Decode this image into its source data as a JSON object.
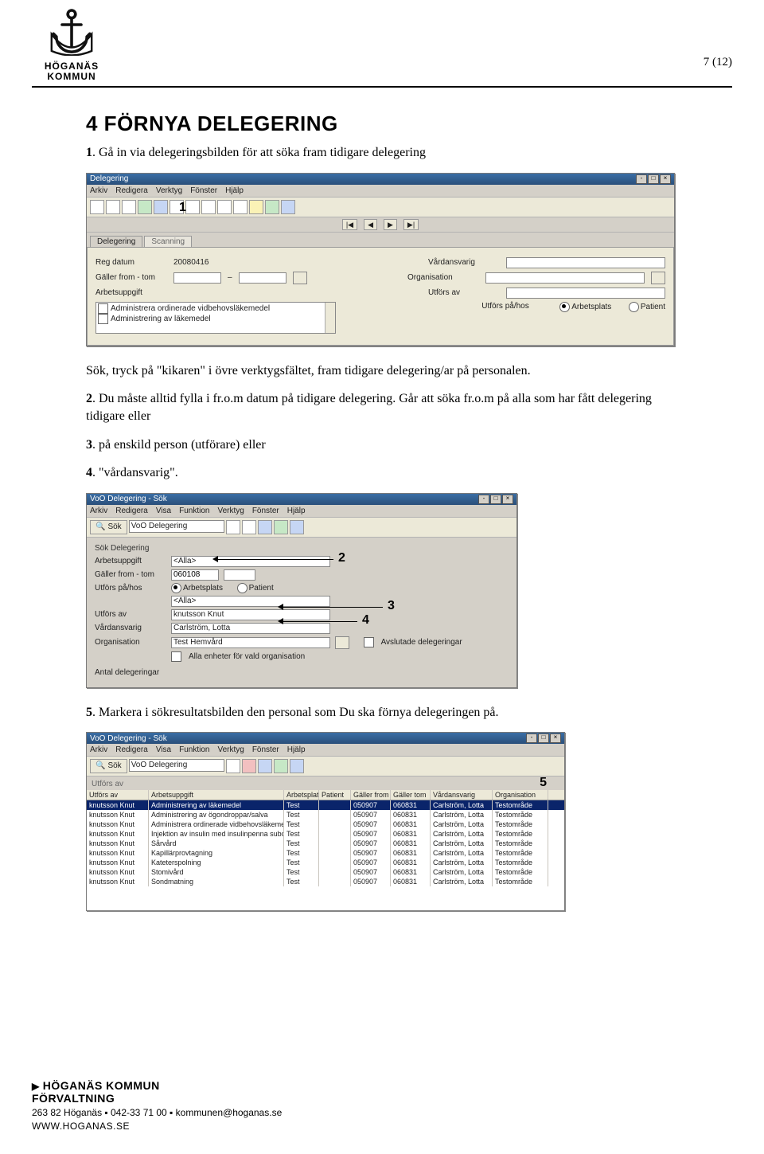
{
  "page": {
    "number_label": "7 (12)"
  },
  "header": {
    "logo_line1": "HÖGANÄS",
    "logo_line2": "KOMMUN"
  },
  "section": {
    "title": "4  FÖRNYA DELEGERING",
    "p1_prefix": "1",
    "p1_text": ". Gå in via delegeringsbilden för att söka fram tidigare delegering",
    "p2": "Sök, tryck på \"kikaren\" i övre verktygsfältet, fram tidigare delegering/ar på personalen.",
    "p3_prefix": "2",
    "p3_text": ". Du måste alltid fylla i fr.o.m datum på tidigare delegering. Går att söka fr.o.m på alla som har fått delegering tidigare eller",
    "p4_prefix": "3",
    "p4_text": ". på enskild person (utförare) eller",
    "p5_prefix": "4",
    "p5_text": ". \"vårdansvarig\".",
    "p6_prefix": "5",
    "p6_text": ". Markera i sökresultatsbilden den personal som Du ska förnya delegeringen på."
  },
  "win1": {
    "title": "Delegering",
    "menu": [
      "Arkiv",
      "Redigera",
      "Verktyg",
      "Fönster",
      "Hjälp"
    ],
    "nav": [
      "|◀",
      "◀",
      "▶",
      "▶|"
    ],
    "tabs": [
      "Delegering",
      "Scanning"
    ],
    "annotation_value": "1",
    "reg_datum_label": "Reg datum",
    "reg_datum_value": "20080416",
    "galler_label": "Gäller from - tom",
    "arbets_label": "Arbetsuppgift",
    "vardansvarig_label": "Vårdansvarig",
    "organisation_label": "Organisation",
    "utfors_av_label": "Utförs av",
    "utfors_pa_label": "Utförs på/hos",
    "radio_arb": "Arbetsplats",
    "radio_pat": "Patient",
    "list_items": [
      "Administrera ordinerade vidbehovsläkemedel",
      "Administrering av läkemedel"
    ]
  },
  "win2": {
    "title": "VoO Delegering - Sök",
    "menu": [
      "Arkiv",
      "Redigera",
      "Visa",
      "Funktion",
      "Verktyg",
      "Fönster",
      "Hjälp"
    ],
    "search_btn": "Sök",
    "search_combo": "VoO Delegering",
    "section": "Sök Delegering",
    "arbets_label": "Arbetsuppgift",
    "arbets_value": "<Alla>",
    "galler_label": "Gäller from - tom",
    "galler_value": "060108",
    "utfors_pa_label": "Utförs på/hos",
    "radio_arb": "Arbetsplats",
    "radio_pat": "Patient",
    "plats_value": "<Alla>",
    "utfors_av_label": "Utförs av",
    "utfors_av_value": "knutsson Knut",
    "vardansvarig_label": "Vårdansvarig",
    "vardansvarig_value": "Carlström, Lotta",
    "organisation_label": "Organisation",
    "organisation_value": "Test Hemvård",
    "chk_avslutade": "Avslutade delegeringar",
    "chk_alla_enh": "Alla enheter för vald organisation",
    "antal_label": "Antal delegeringar",
    "ann2": "2",
    "ann3": "3",
    "ann4": "4"
  },
  "win3": {
    "title": "VoO Delegering - Sök",
    "menu": [
      "Arkiv",
      "Redigera",
      "Visa",
      "Funktion",
      "Verktyg",
      "Fönster",
      "Hjälp"
    ],
    "search_btn": "Sök",
    "search_combo": "VoO Delegering",
    "utfors_av_label": "Utförs av",
    "columns": [
      "Utförs av",
      "Arbetsuppgift",
      "Arbetsplats",
      "Patient",
      "Gäller from",
      "Gäller tom",
      "Vårdansvarig",
      "Organisation"
    ],
    "ann5": "5",
    "rows": [
      {
        "c": [
          "knutsson Knut",
          "Administrering av läkemedel",
          "Test",
          "",
          "050907",
          "060831",
          "Carlström, Lotta",
          "Testområde"
        ],
        "sel": true
      },
      {
        "c": [
          "knutsson Knut",
          "Administrering av ögondroppar/salva",
          "Test",
          "",
          "050907",
          "060831",
          "Carlström, Lotta",
          "Testområde"
        ]
      },
      {
        "c": [
          "knutsson Knut",
          "Administrera ordinerade vidbehovsläkemedel",
          "Test",
          "",
          "050907",
          "060831",
          "Carlström, Lotta",
          "Testområde"
        ]
      },
      {
        "c": [
          "knutsson Knut",
          "Injektion av insulin med insulinpenna subcutant",
          "Test",
          "",
          "050907",
          "060831",
          "Carlström, Lotta",
          "Testområde"
        ]
      },
      {
        "c": [
          "knutsson Knut",
          "Sårvård",
          "Test",
          "",
          "050907",
          "060831",
          "Carlström, Lotta",
          "Testområde"
        ]
      },
      {
        "c": [
          "knutsson Knut",
          "Kapillärprovtagning",
          "Test",
          "",
          "050907",
          "060831",
          "Carlström, Lotta",
          "Testområde"
        ]
      },
      {
        "c": [
          "knutsson Knut",
          "Kateterspolning",
          "Test",
          "",
          "050907",
          "060831",
          "Carlström, Lotta",
          "Testområde"
        ]
      },
      {
        "c": [
          "knutsson Knut",
          "Stomivård",
          "Test",
          "",
          "050907",
          "060831",
          "Carlström, Lotta",
          "Testområde"
        ]
      },
      {
        "c": [
          "knutsson Knut",
          "Sondmatning",
          "Test",
          "",
          "050907",
          "060831",
          "Carlström, Lotta",
          "Testområde"
        ]
      }
    ]
  },
  "footer": {
    "line1": "HÖGANÄS KOMMUN",
    "line2": "FÖRVALTNING",
    "line3": "263 82 Höganäs ▪ 042-33 71 00 ▪ kommunen@hoganas.se",
    "line4": "WWW.HOGANAS.SE"
  }
}
